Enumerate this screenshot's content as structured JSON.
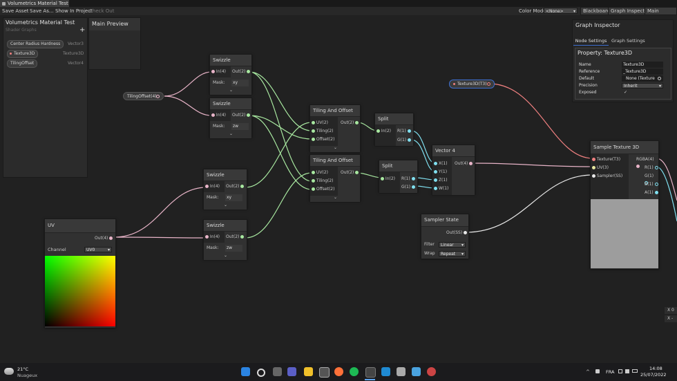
{
  "window": {
    "title": "Volumetrics Material Test"
  },
  "toolbar": {
    "save_asset": "Save Asset",
    "save_as": "Save As...",
    "show_in_project": "Show In Project",
    "check_out": "Check Out",
    "color_mode_label": "Color Mode",
    "color_mode_value": "<None>",
    "blackboard": "Blackboard",
    "graph_inspector": "Graph Inspector",
    "main_preview": "Main Preview"
  },
  "blackboard": {
    "title": "Volumetrics Material Test",
    "subtitle": "Shader Graphs",
    "add": "+",
    "properties": [
      {
        "name": "Center Radius Hardness",
        "type": "Vector3"
      },
      {
        "name": "Texture3D",
        "type": "Texture3D"
      },
      {
        "name": "TilingOffset",
        "type": "Vector4"
      }
    ]
  },
  "main_preview": {
    "title": "Main Preview"
  },
  "inspector": {
    "title": "Graph Inspector",
    "tab_node": "Node Settings",
    "tab_graph": "Graph Settings",
    "property_title": "Property: Texture3D",
    "rows": [
      {
        "label": "Name",
        "value": "Texture3D"
      },
      {
        "label": "Reference",
        "value": "_Texture3D"
      },
      {
        "label": "Default",
        "value": "None (Texture"
      },
      {
        "label": "Precision",
        "value": "Inherit"
      },
      {
        "label": "Exposed",
        "value": "✓"
      }
    ]
  },
  "nodes": {
    "tiling_prop": {
      "label": "TilingOffset(4)"
    },
    "texture_prop": {
      "label": "Texture3D(T3)"
    },
    "swizzle1": {
      "title": "Swizzle",
      "in": "In(4)",
      "out": "Out(2)",
      "mask_label": "Mask:",
      "mask": "xy"
    },
    "swizzle2": {
      "title": "Swizzle",
      "in": "In(4)",
      "out": "Out(2)",
      "mask_label": "Mask:",
      "mask": "zw"
    },
    "swizzle3": {
      "title": "Swizzle",
      "in": "In(4)",
      "out": "Out(2)",
      "mask_label": "Mask:",
      "mask": "xy"
    },
    "swizzle4": {
      "title": "Swizzle",
      "in": "In(4)",
      "out": "Out(2)",
      "mask_label": "Mask:",
      "mask": "zw"
    },
    "tiling1": {
      "title": "Tiling And Offset",
      "in1": "UV(2)",
      "in2": "Tiling(2)",
      "in3": "Offset(2)",
      "out": "Out(2)"
    },
    "tiling2": {
      "title": "Tiling And Offset",
      "in1": "UV(2)",
      "in2": "Tiling(2)",
      "in3": "Offset(2)",
      "out": "Out(2)"
    },
    "split1": {
      "title": "Split",
      "in": "In(2)",
      "o1": "R(1)",
      "o2": "G(1)"
    },
    "split2": {
      "title": "Split",
      "in": "In(2)",
      "o1": "R(1)",
      "o2": "G(1)"
    },
    "vector4": {
      "title": "Vector 4",
      "x": "X(1)",
      "y": "Y(1)",
      "z": "Z(1)",
      "w": "W(1)",
      "out": "Out(4)"
    },
    "uv": {
      "title": "UV",
      "out": "Out(4)",
      "channel_label": "Channel",
      "channel": "UV0"
    },
    "sampler": {
      "title": "Sampler State",
      "out": "Out(SS)",
      "filter_label": "Filter",
      "filter": "Linear",
      "wrap_label": "Wrap",
      "wrap": "Repeat"
    },
    "sample3d": {
      "title": "Sample Texture 3D",
      "in1": "Texture(T3)",
      "in2": "UV(3)",
      "in3": "Sampler(SS)",
      "o1": "RGBA(4)",
      "o2": "R(1)",
      "o3": "G(1)",
      "o4": "B(1)",
      "o5": "A(1)"
    }
  },
  "right_edge": {
    "x_label": "X",
    "x_value": "0",
    "x2_label": "X",
    "x2_value": "-"
  },
  "taskbar": {
    "temp": "21°C",
    "weather": "Nuageux",
    "lang": "FRA",
    "time": "14:08",
    "date": "25/07/2022"
  },
  "colors": {
    "wire_pink": "#e8b4c8",
    "wire_green": "#a8e8a0",
    "wire_cyan": "#80e0f0",
    "wire_red": "#f08080",
    "wire_white": "#e8e8e8",
    "accent_blue": "#3d6ecf"
  }
}
